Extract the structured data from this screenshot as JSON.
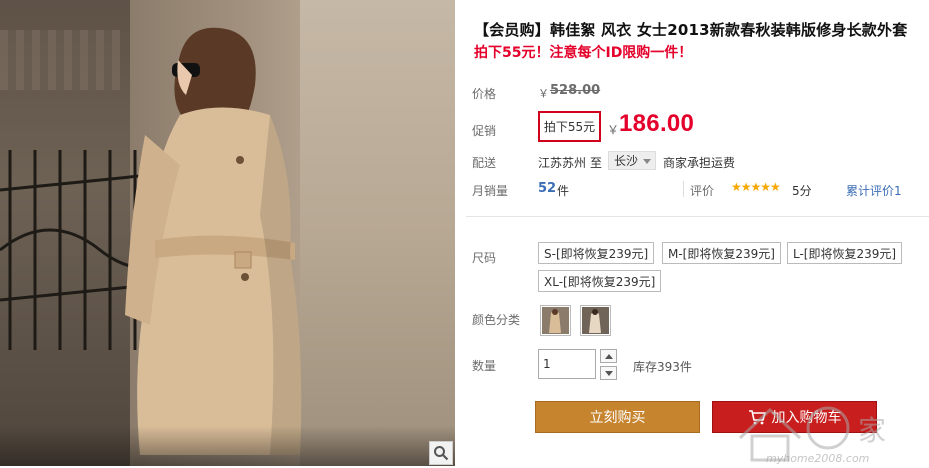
{
  "product": {
    "title": "【会员购】韩佳絮 风衣 女士2013新款春秋装韩版修身长款外套",
    "subtitle": "拍下55元！注意每个ID限购一件！"
  },
  "price": {
    "label": "价格",
    "currency": "￥",
    "original": "528.00"
  },
  "promo": {
    "label": "促销",
    "badge": "拍下55元",
    "currency": "￥",
    "price": "186.00"
  },
  "delivery": {
    "label": "配送",
    "from": "江苏苏州",
    "to": "至",
    "city": "长沙",
    "note": "商家承担运费"
  },
  "sales": {
    "label": "月销量",
    "count": "52",
    "unit": "件",
    "review_label": "评价",
    "stars": "★★★★★",
    "score": "5分",
    "review_text": "累计评价1"
  },
  "size": {
    "label": "尺码",
    "options": [
      "S-[即将恢复239元]",
      "M-[即将恢复239元]",
      "L-[即将恢复239元]",
      "XL-[即将恢复239元]"
    ]
  },
  "color": {
    "label": "颜色分类"
  },
  "quantity": {
    "label": "数量",
    "value": "1",
    "stock": "库存393件"
  },
  "actions": {
    "buy": "立刻购买",
    "cart": "加入购物车"
  },
  "watermark": {
    "text": "myhome2008.com",
    "brand": "家"
  },
  "colors": {
    "price_red": "#e4002b",
    "buy_orange": "#c6842f",
    "cart_red": "#c81e1e",
    "link_blue": "#3c6db5",
    "star_orange": "#f6a800"
  }
}
